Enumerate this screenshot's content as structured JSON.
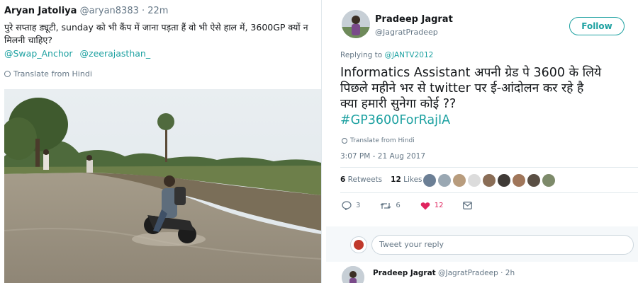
{
  "left_tweet": {
    "name": "Aryan Jatoliya",
    "handle": "@aryan8383",
    "time": "· 22m",
    "text": "पुरे सप्ताह ड्यूटी, sunday को भी कैंप में जाना पड़ता हैं वो भी ऐसे हाल में, 3600GP क्यों न मिलनी चाहिए?",
    "mentions": [
      "@Swap_Anchor",
      "@zeerajasthan_"
    ],
    "translate": "Translate from Hindi",
    "photo_caption": ""
  },
  "right_tweet": {
    "name": "Pradeep Jagrat",
    "handle": "@JagratPradeep",
    "follow_label": "Follow",
    "replying_prefix": "Replying to",
    "replying_to": "@JANTV2012",
    "text_lines": [
      "Informatics Assistant अपनी ग्रेड पे 3600 के लिये",
      "पिछले महीने भर से twitter पर ई-आंदोलन कर रहे है",
      "क्या हमारी सुनेगा कोई ??"
    ],
    "hashtag": "#GP3600ForRajIA",
    "translate": "Translate from Hindi",
    "timestamp": "3:07 PM - 21 Aug 2017",
    "retweets_count": "6",
    "retweets_label": "Retweets",
    "likes_count": "12",
    "likes_label": "Likes",
    "reply_count": "3",
    "retweet_action_count": "6",
    "like_action_count": "12",
    "reply_placeholder": "Tweet your reply",
    "next_reply": {
      "name": "Pradeep Jagrat",
      "handle": "@JagratPradeep",
      "time": "· 2h"
    }
  },
  "colors": {
    "accent": "#1da1a1",
    "like": "#e0245e",
    "muted": "#657786"
  }
}
